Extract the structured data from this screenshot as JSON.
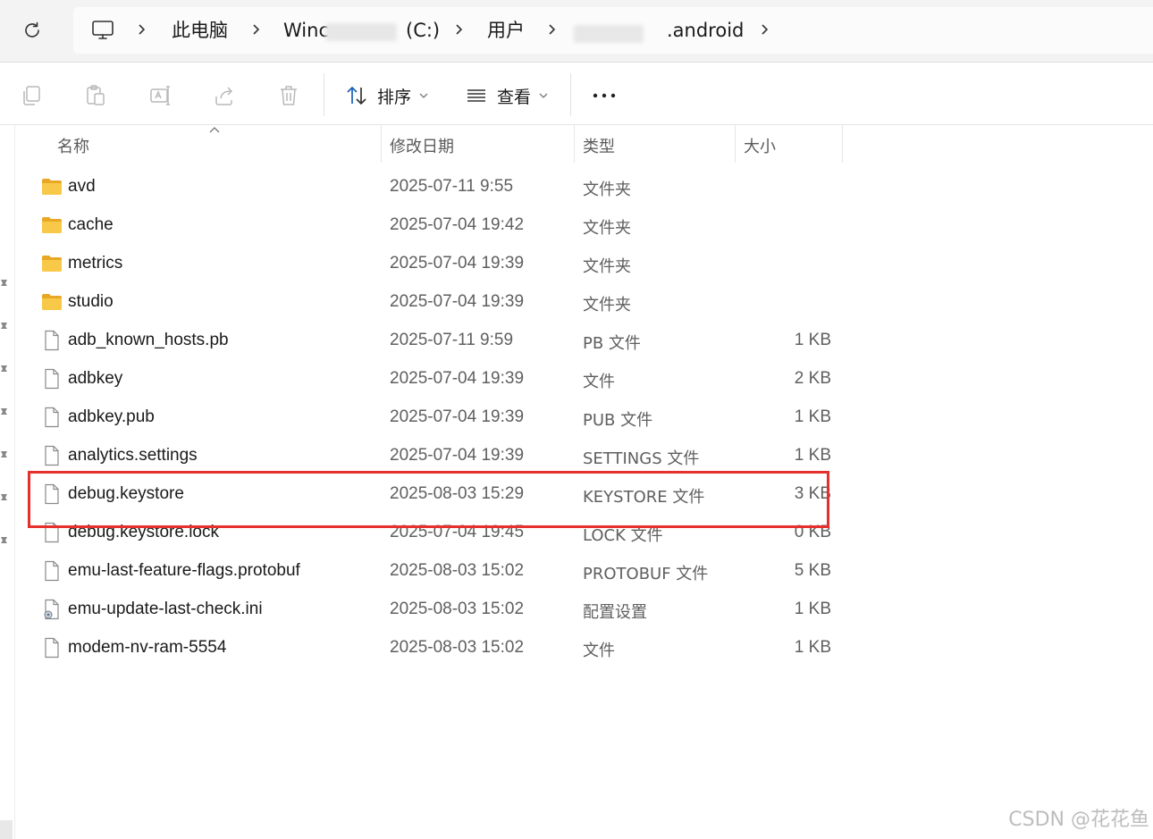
{
  "breadcrumb": {
    "items": [
      "此电脑",
      "Winc",
      "(C:)",
      "用户",
      ".android"
    ]
  },
  "toolbar": {
    "sort_label": "排序",
    "view_label": "查看",
    "more_label": "•••"
  },
  "columns": {
    "name": "名称",
    "date": "修改日期",
    "type": "类型",
    "size": "大小"
  },
  "files": [
    {
      "name": "avd",
      "date": "2025-07-11 9:55",
      "type": "文件夹",
      "size": "",
      "icon": "folder-icon"
    },
    {
      "name": "cache",
      "date": "2025-07-04 19:42",
      "type": "文件夹",
      "size": "",
      "icon": "folder-icon"
    },
    {
      "name": "metrics",
      "date": "2025-07-04 19:39",
      "type": "文件夹",
      "size": "",
      "icon": "folder-icon"
    },
    {
      "name": "studio",
      "date": "2025-07-04 19:39",
      "type": "文件夹",
      "size": "",
      "icon": "folder-icon"
    },
    {
      "name": "adb_known_hosts.pb",
      "date": "2025-07-11 9:59",
      "type": "PB 文件",
      "size": "1 KB",
      "icon": "file-icon"
    },
    {
      "name": "adbkey",
      "date": "2025-07-04 19:39",
      "type": "文件",
      "size": "2 KB",
      "icon": "file-icon"
    },
    {
      "name": "adbkey.pub",
      "date": "2025-07-04 19:39",
      "type": "PUB 文件",
      "size": "1 KB",
      "icon": "file-icon"
    },
    {
      "name": "analytics.settings",
      "date": "2025-07-04 19:39",
      "type": "SETTINGS 文件",
      "size": "1 KB",
      "icon": "file-icon"
    },
    {
      "name": "debug.keystore",
      "date": "2025-08-03 15:29",
      "type": "KEYSTORE 文件",
      "size": "3 KB",
      "icon": "file-icon"
    },
    {
      "name": "debug.keystore.lock",
      "date": "2025-07-04 19:45",
      "type": "LOCK 文件",
      "size": "0 KB",
      "icon": "file-icon"
    },
    {
      "name": "emu-last-feature-flags.protobuf",
      "date": "2025-08-03 15:02",
      "type": "PROTOBUF 文件",
      "size": "5 KB",
      "icon": "file-icon"
    },
    {
      "name": "emu-update-last-check.ini",
      "date": "2025-08-03 15:02",
      "type": "配置设置",
      "size": "1 KB",
      "icon": "settings-file-icon"
    },
    {
      "name": "modem-nv-ram-5554",
      "date": "2025-08-03 15:02",
      "type": "文件",
      "size": "1 KB",
      "icon": "file-icon"
    }
  ],
  "watermark": "CSDN @花花鱼",
  "colors": {
    "highlight": "#e5302c",
    "folder": "#f8c948",
    "accent": "#0067c0"
  }
}
